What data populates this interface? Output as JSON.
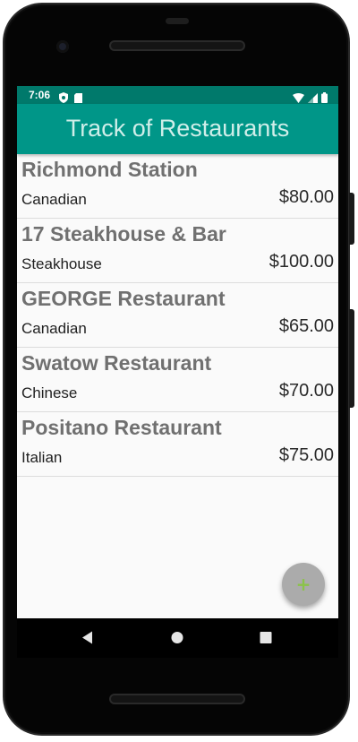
{
  "status_bar": {
    "time": "7:06",
    "left_icons": [
      "shield-icon",
      "sd-card-icon"
    ],
    "right_icons": [
      "wifi-icon",
      "signal-icon",
      "battery-icon"
    ]
  },
  "app_bar": {
    "title": "Track of Restaurants"
  },
  "restaurants": [
    {
      "name": "Richmond Station",
      "cuisine": "Canadian",
      "price": "$80.00"
    },
    {
      "name": "17 Steakhouse & Bar",
      "cuisine": "Steakhouse",
      "price": "$100.00"
    },
    {
      "name": "GEORGE Restaurant",
      "cuisine": "Canadian",
      "price": "$65.00"
    },
    {
      "name": "Swatow Restaurant",
      "cuisine": "Chinese",
      "price": "$70.00"
    },
    {
      "name": "Positano Restaurant",
      "cuisine": "Italian",
      "price": "$75.00"
    }
  ],
  "fab": {
    "label": "+",
    "icon": "add-icon"
  },
  "nav_bar": {
    "buttons": [
      "back-icon",
      "home-icon",
      "recents-icon"
    ]
  },
  "colors": {
    "status_bar": "#00796b",
    "app_bar": "#009688",
    "title_text": "#cfeee9",
    "fab": "#ababab",
    "fab_icon": "#8bc34a"
  }
}
